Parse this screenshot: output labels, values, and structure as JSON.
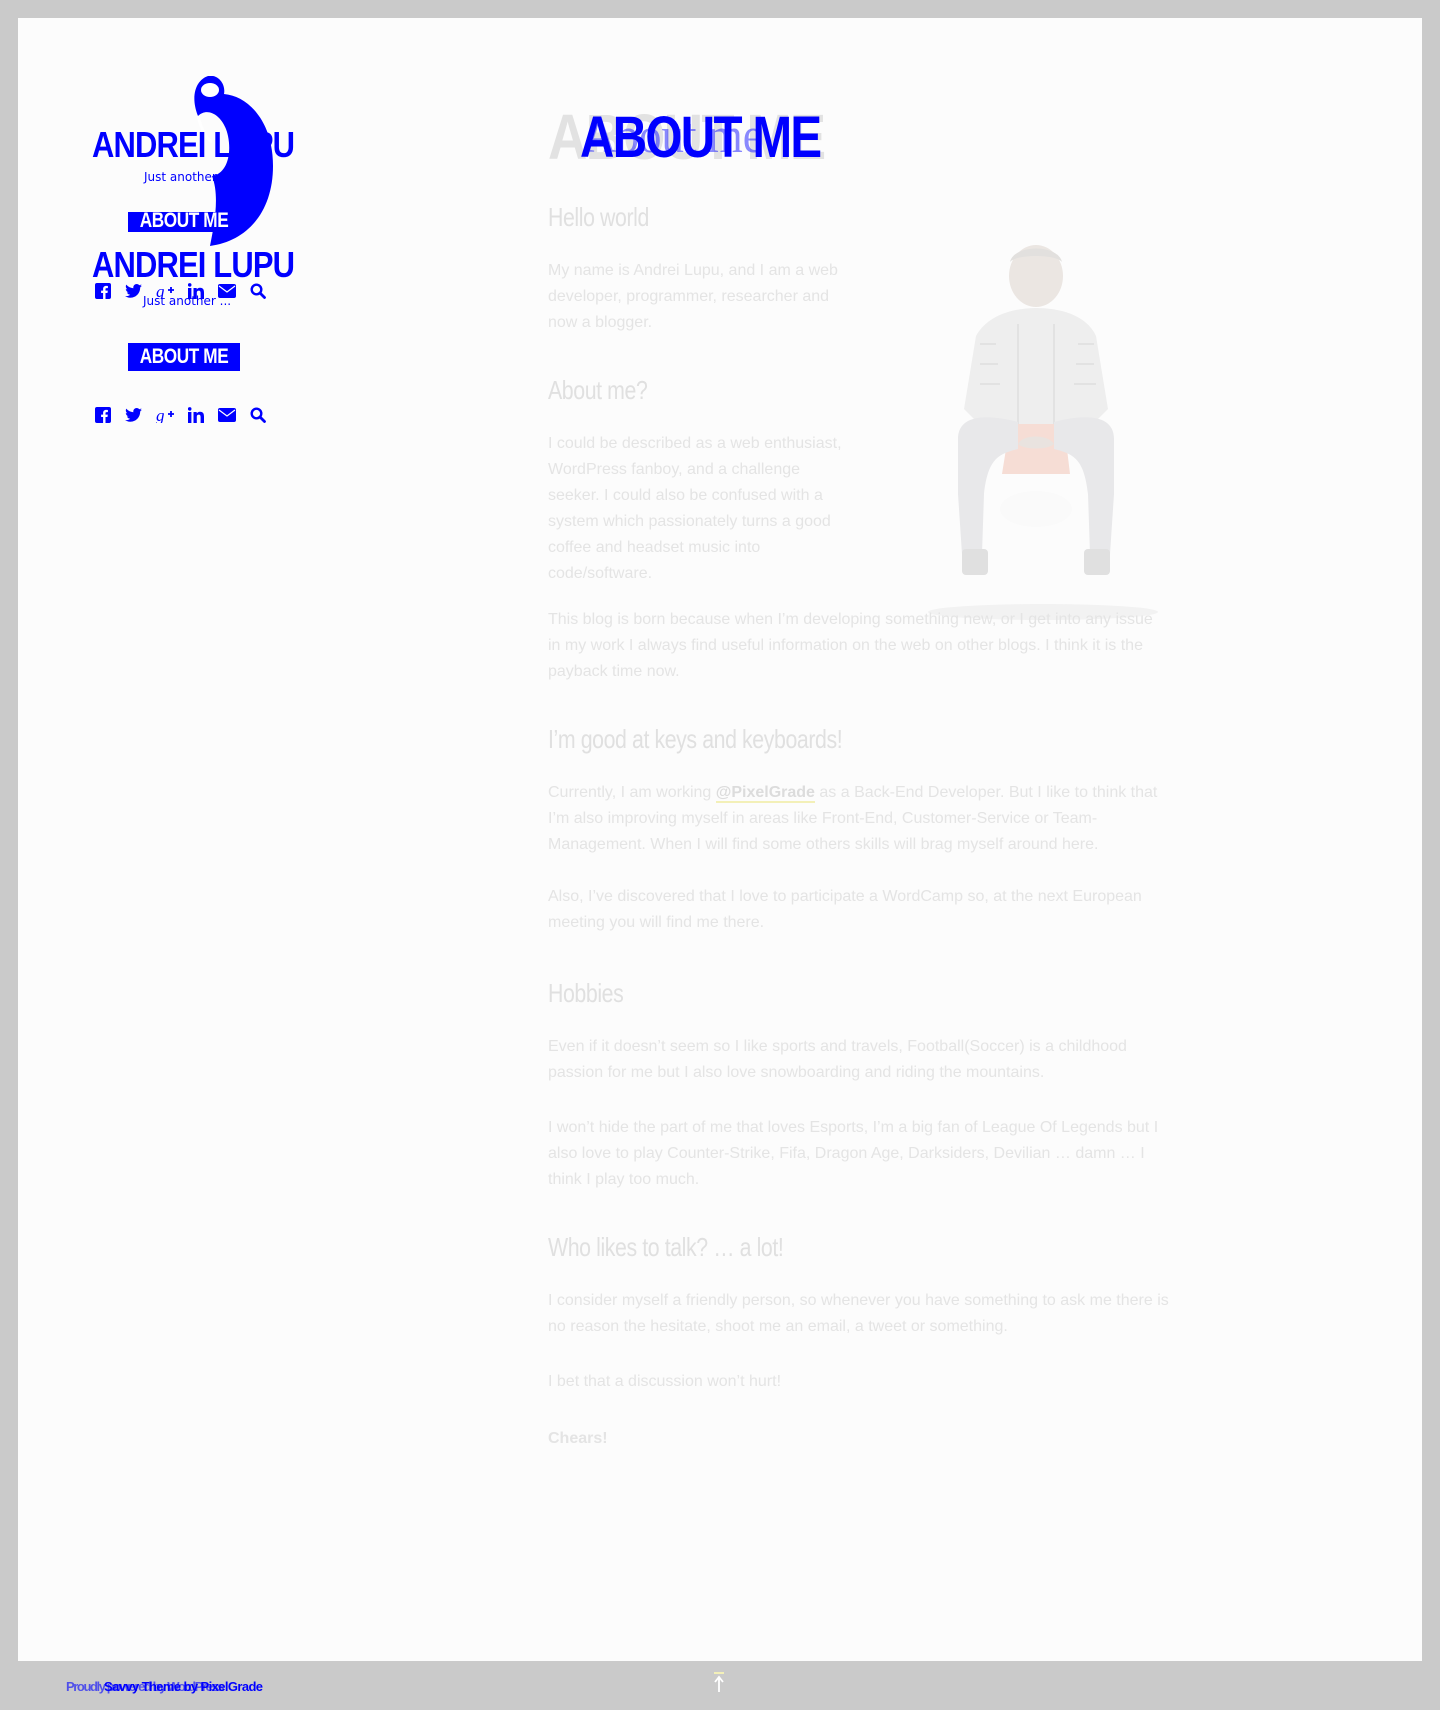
{
  "sidebar": {
    "site_title": "ANDREI LUPU",
    "tagline": "Just another ...",
    "tagline_clipped": "Just another",
    "menu_item": "ABOUT ME",
    "social_icons": [
      "facebook-icon",
      "twitter-icon",
      "google-plus-icon",
      "linkedin-icon",
      "email-icon",
      "search-icon"
    ]
  },
  "page": {
    "title": "ABOUT ME",
    "title_ghost": "About me",
    "sections": [
      {
        "heading": "Hello world",
        "paragraphs": [
          "My name is Andrei Lupu, and I am a web developer, programmer, researcher and now a blogger."
        ]
      },
      {
        "heading": "About me?",
        "paragraphs": [
          "I could be described as a web enthusiast, WordPress fanboy, and a challenge seeker. I could also be confused with a system which passionately turns a good coffee and headset music into code/software.",
          "This blog is born because when I’m developing something new, or I get into any issue in my work I always find useful information on the web on other blogs. I think it is the payback time now."
        ]
      },
      {
        "heading": "I’m good at keys and keyboards!",
        "p1_before": "Currently, I am working ",
        "p1_link": "@PixelGrade",
        "p1_after": " as a Back-End Developer. But I like to think that I’m also improving myself in areas like Front-End, Customer-Service or Team-Management. When I will find some others skills will brag myself around here.",
        "p2": "Also, I’ve discovered that I love to participate a WordCamp so, at the next European meeting you will find me there."
      },
      {
        "heading": "Hobbies",
        "paragraphs": [
          "Even if it doesn’t seem so I like sports and travels, Football(Soccer) is a childhood passion for me but I also love snowboarding and riding the mountains.",
          "I won’t hide the part of me that loves Esports, I’m a big fan of League Of Legends but I also love to play Counter-Strike, Fifa, Dragon Age, Darksiders, Devilian … damn … I think I play too much."
        ]
      },
      {
        "heading": "Who likes to talk? … a lot!",
        "paragraphs": [
          "I consider myself a friendly person, so whenever you have something to ask me there is no reason the hesitate, shoot me an email, a tweet or something.",
          "I bet that a discussion won’t hurt!"
        ],
        "signoff": "Chears!"
      }
    ]
  },
  "footer": {
    "credit": "Savvy Theme by PixelGrade",
    "credit_ghost": "Proudly powered by WordPress"
  },
  "colors": {
    "frame_background": "#cacaca",
    "page_background": "#fcfcfc",
    "accent_blue": "#0000ff",
    "muted_text": "#e4e4e4",
    "link_underline": "#f3f0b8"
  }
}
